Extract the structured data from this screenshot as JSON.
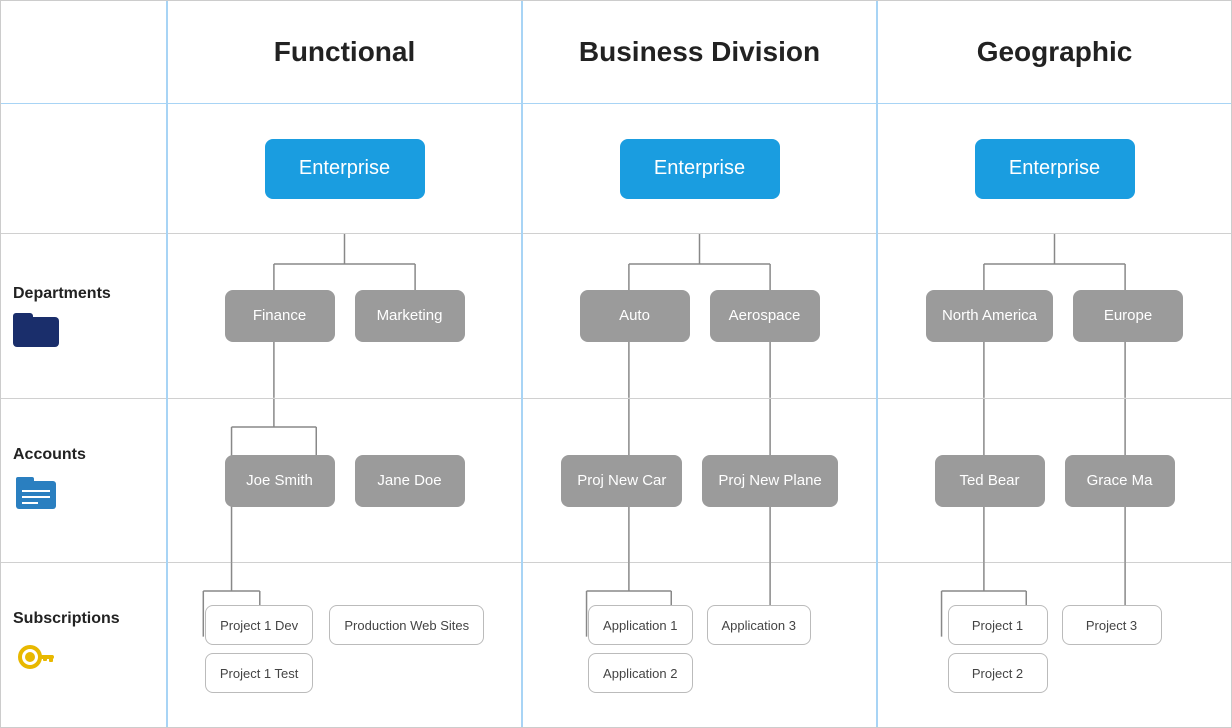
{
  "headers": {
    "col1": "Functional",
    "col2": "Business Division",
    "col3": "Geographic"
  },
  "labels": {
    "row1": "Departments",
    "row2": "Accounts",
    "row3": "Subscriptions"
  },
  "icons": {
    "folder": "📁",
    "accounts": "🗂",
    "key": "🔑"
  },
  "functional": {
    "enterprise": "Enterprise",
    "departments": [
      "Finance",
      "Marketing"
    ],
    "accounts": [
      "Joe Smith",
      "Jane Doe"
    ],
    "subscriptions_left": [
      "Project 1 Dev",
      "Project 1 Test"
    ],
    "subscriptions_right": [
      "Production Web Sites"
    ]
  },
  "business": {
    "enterprise": "Enterprise",
    "departments": [
      "Auto",
      "Aerospace"
    ],
    "accounts": [
      "Proj New Car",
      "Proj New Plane"
    ],
    "subscriptions_left": [
      "Application 1",
      "Application 2"
    ],
    "subscriptions_right": [
      "Application 3"
    ]
  },
  "geographic": {
    "enterprise": "Enterprise",
    "departments": [
      "North America",
      "Europe"
    ],
    "accounts": [
      "Ted Bear",
      "Grace Ma"
    ],
    "subscriptions_left": [
      "Project 1",
      "Project 2"
    ],
    "subscriptions_right": [
      "Project 3"
    ]
  },
  "colors": {
    "blue_node": "#1a9de0",
    "gray_node": "#9b9b9b",
    "border_col": "#a8d4f5",
    "folder_icon": "#1a2e6b",
    "accounts_icon": "#2a7fc0",
    "key_icon": "#e8b800"
  }
}
